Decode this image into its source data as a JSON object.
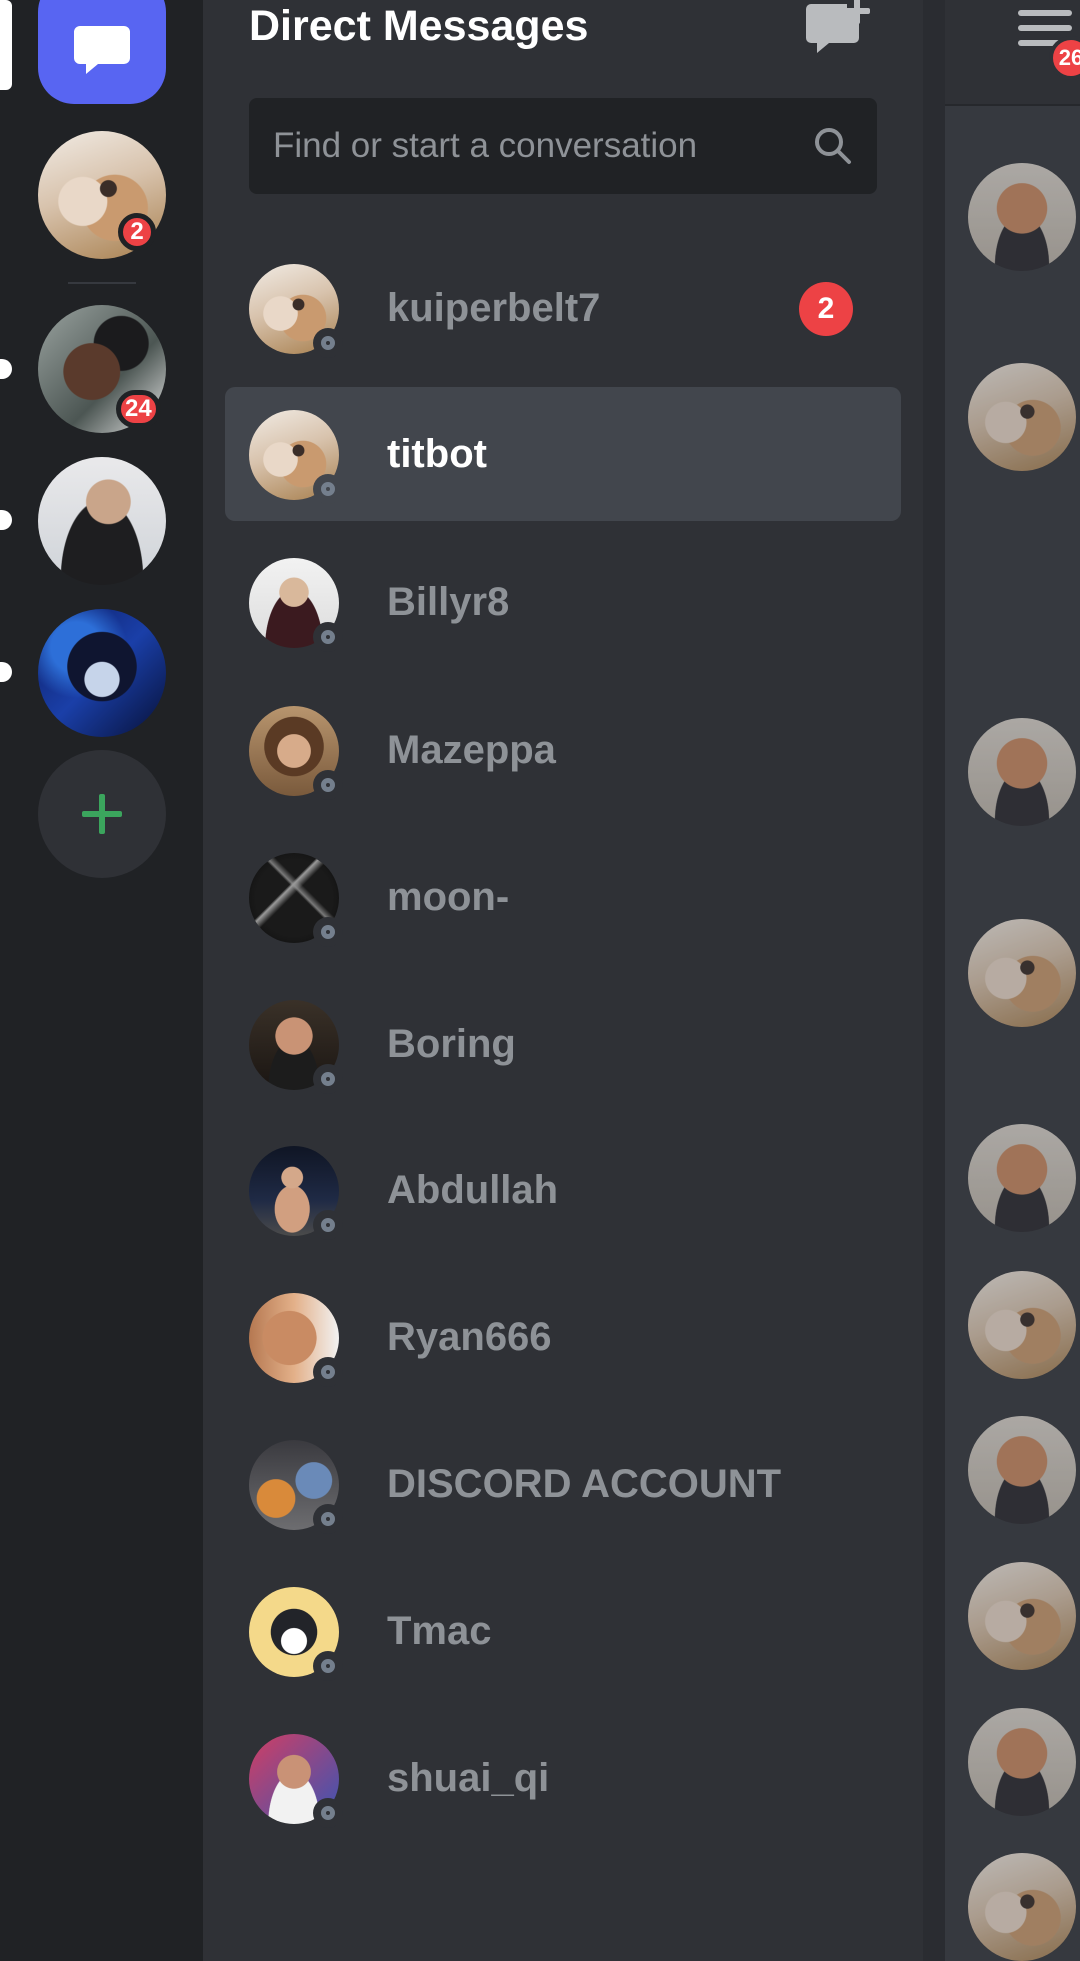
{
  "app": {
    "title": "Direct Messages"
  },
  "colors": {
    "blurple": "#5865f2",
    "mention_red": "#ed4245",
    "add_green": "#3ba55d",
    "panel_bg": "#2f3136",
    "rail_bg": "#202225",
    "selected_row": "#42464d",
    "muted_text": "#8e9297"
  },
  "server_rail": {
    "home_icon": "chat-bubble-icon",
    "servers": [
      {
        "name": "dog-server",
        "avatar": "dog",
        "badge": "2"
      },
      {
        "name": "smoke-server",
        "avatar": "smoke",
        "badge": "24"
      },
      {
        "name": "jacket-server",
        "avatar": "man-jacket",
        "badge": ""
      },
      {
        "name": "anime-server",
        "avatar": "anime",
        "badge": ""
      }
    ],
    "add_icon": "plus-icon"
  },
  "search": {
    "placeholder": "Find or start a conversation",
    "icon": "search-icon"
  },
  "new_dm_icon": "new-message-plus-icon",
  "dms": [
    {
      "name": "kuiperbelt7",
      "avatar": "dog",
      "status": "offline",
      "badge": "2",
      "selected": false
    },
    {
      "name": "titbot",
      "avatar": "dog",
      "status": "offline",
      "badge": "",
      "selected": true
    },
    {
      "name": "Billyr8",
      "avatar": "suit",
      "status": "offline",
      "badge": "",
      "selected": false
    },
    {
      "name": "Mazeppa",
      "avatar": "woman",
      "status": "offline",
      "badge": "",
      "selected": false
    },
    {
      "name": "moon-",
      "avatar": "dark",
      "status": "offline",
      "badge": "",
      "selected": false
    },
    {
      "name": "Boring",
      "avatar": "boring",
      "status": "offline",
      "badge": "",
      "selected": false
    },
    {
      "name": "Abdullah",
      "avatar": "fighter",
      "status": "offline",
      "badge": "",
      "selected": false
    },
    {
      "name": "Ryan666",
      "avatar": "ryan",
      "status": "offline",
      "badge": "",
      "selected": false
    },
    {
      "name": "DISCORD ACCOUNT",
      "avatar": "discord",
      "status": "offline",
      "badge": "",
      "selected": false
    },
    {
      "name": "Tmac",
      "avatar": "tmac",
      "status": "offline",
      "badge": "",
      "selected": false
    },
    {
      "name": "shuai_qi",
      "avatar": "shuai",
      "status": "offline",
      "badge": "",
      "selected": false
    }
  ],
  "chat_peek": {
    "menu_icon": "hamburger-menu-icon",
    "menu_badge": "26",
    "avatars": [
      "bald",
      "dog",
      "bald",
      "dog",
      "bald",
      "dog",
      "bald",
      "dog",
      "bald",
      "dog"
    ]
  }
}
